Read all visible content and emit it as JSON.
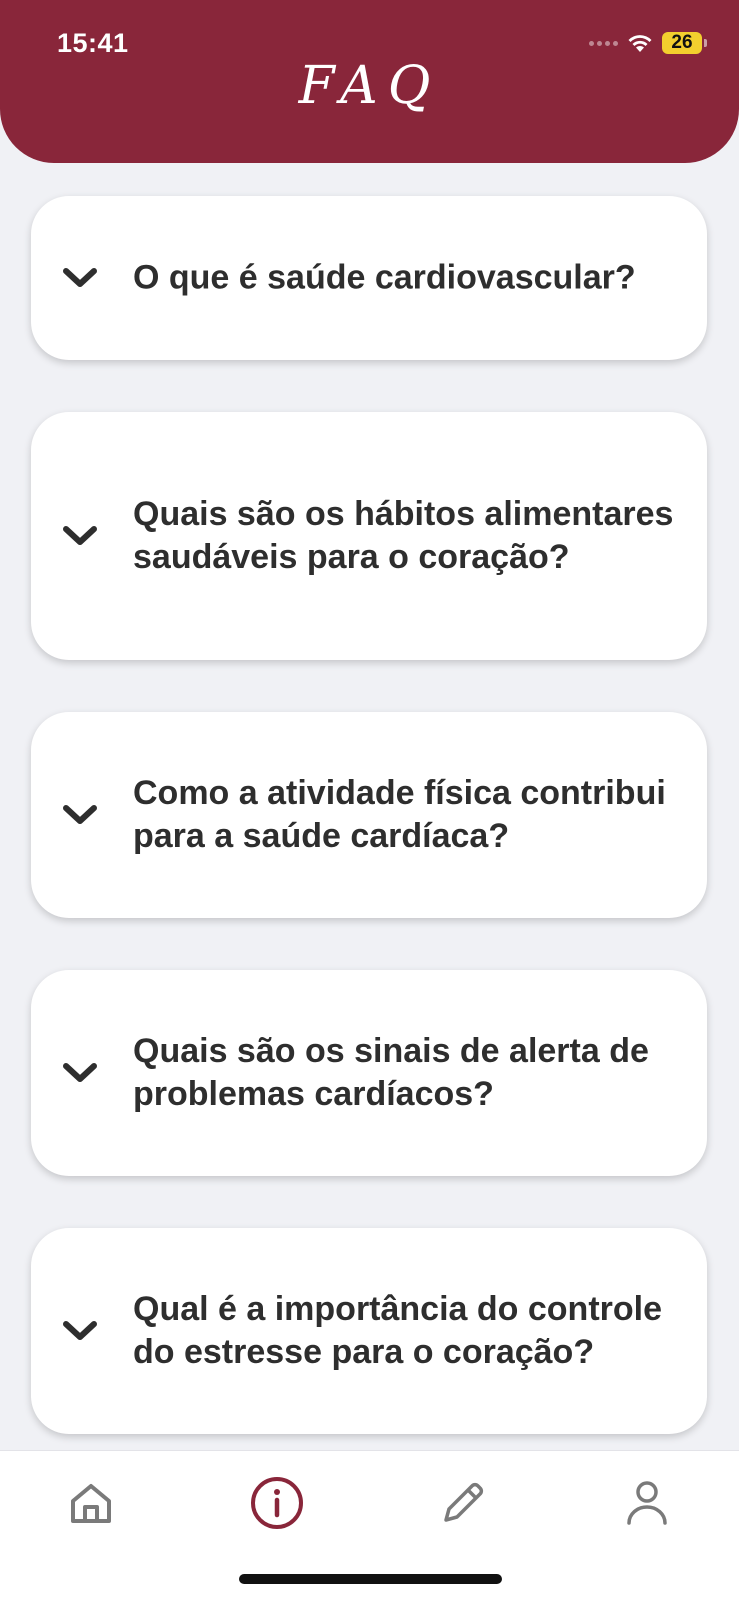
{
  "status_bar": {
    "time": "15:41",
    "battery": "26",
    "wifi_icon": "wifi-icon",
    "signal_icon": "cellular-signal-icon"
  },
  "header": {
    "title": "FAQ",
    "background_color": "#89263a"
  },
  "faq": {
    "items": [
      {
        "question": "O que é saúde cardiovascular?",
        "icon": "chevron-down-icon"
      },
      {
        "question": "Quais são os hábitos alimentares saudáveis para o coração?",
        "icon": "chevron-down-icon"
      },
      {
        "question": "Como a atividade física contribui para a saúde cardíaca?",
        "icon": "chevron-down-icon"
      },
      {
        "question": "Quais são os sinais de alerta de problemas cardíacos?",
        "icon": "chevron-down-icon"
      },
      {
        "question": "Qual é a importância do controle do estresse para o coração?",
        "icon": "chevron-down-icon"
      }
    ]
  },
  "tab_bar": {
    "tabs": [
      {
        "icon": "home-icon",
        "active": false
      },
      {
        "icon": "info-icon",
        "active": true
      },
      {
        "icon": "pencil-icon",
        "active": false
      },
      {
        "icon": "user-icon",
        "active": false
      }
    ],
    "active_color": "#89263a",
    "inactive_color": "#7a7a7a"
  }
}
